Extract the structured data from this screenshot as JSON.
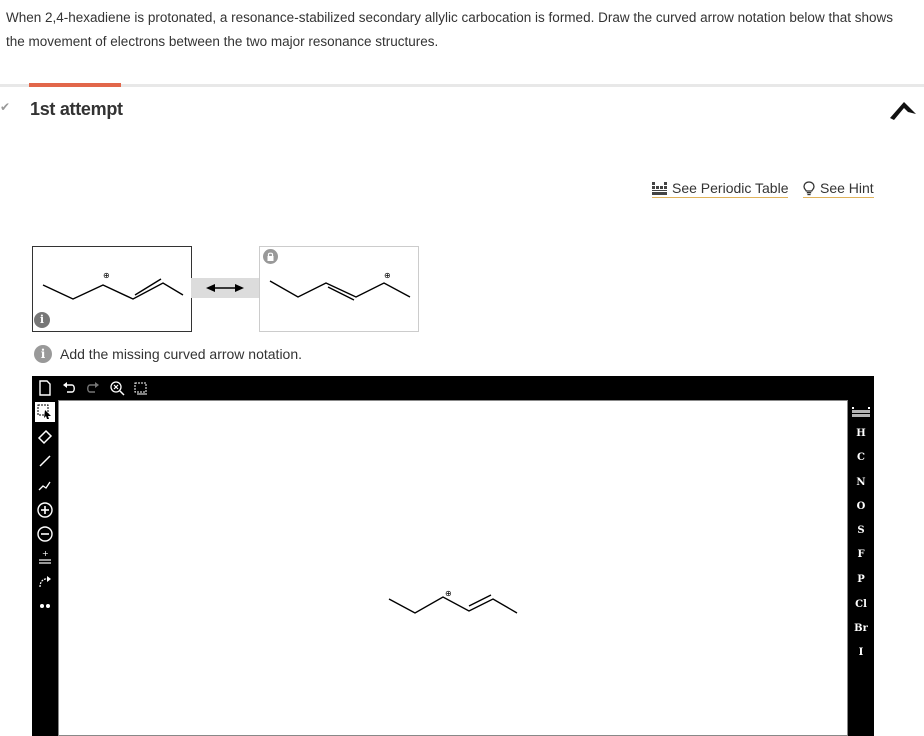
{
  "question": {
    "text": "When 2,4-hexadiene is protonated, a resonance-stabilized secondary allylic carbocation is formed. Draw the curved arrow notation below that shows the movement of electrons between the two major resonance structures."
  },
  "attempt": {
    "title": "1st attempt"
  },
  "links": {
    "periodic_table": "See Periodic Table",
    "hint": "See Hint"
  },
  "structures": {
    "charge_symbol": "⊕",
    "info_glyph": "i"
  },
  "info": {
    "message": "Add the missing curved arrow notation."
  },
  "editor": {
    "elements": [
      "H",
      "C",
      "N",
      "O",
      "S",
      "F",
      "P",
      "Cl",
      "Br",
      "I"
    ],
    "charge_symbol": "⊕"
  },
  "colors": {
    "accent": "#e2674a",
    "link_underline": "#e0b25a",
    "editor_bg": "#000000"
  }
}
